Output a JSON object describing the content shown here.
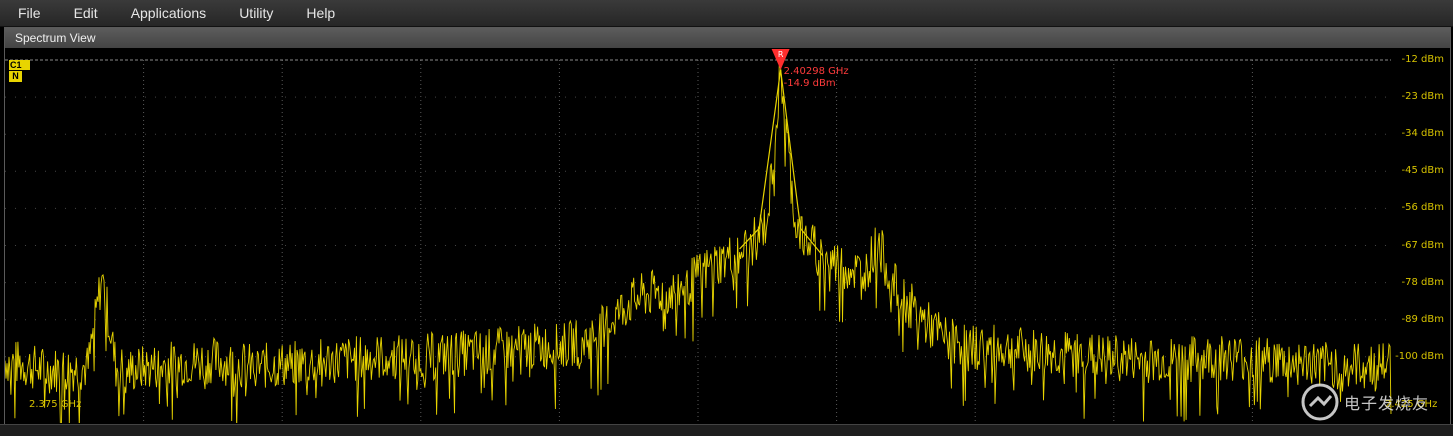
{
  "menu": [
    "File",
    "Edit",
    "Applications",
    "Utility",
    "Help"
  ],
  "panel": {
    "title": "Spectrum View"
  },
  "channel_badge": {
    "channel": "C1",
    "mode": "N"
  },
  "colors": {
    "trace": "#e8d400",
    "marker": "#ff2e2e",
    "grid": "#5a5a5a"
  },
  "marker": {
    "symbol": "R",
    "freq_label": "2.40298 GHz",
    "level_label": "-14.9 dBm"
  },
  "watermark": {
    "text": "电子发烧友"
  },
  "chart_data": {
    "type": "line",
    "y_tick_labels": [
      "-12 dBm",
      "-23 dBm",
      "-34 dBm",
      "-45 dBm",
      "-56 dBm",
      "-67 dBm",
      "-78 dBm",
      "-89 dBm",
      "-100 dBm"
    ],
    "ylim": [
      -122,
      -12
    ],
    "xlim": [
      2.375,
      2.425
    ],
    "x_start_label": "2.375 GHz",
    "x_end_label": "2.425 GHz",
    "grid": true,
    "series": [
      {
        "x": [
          2.375,
          2.3765,
          2.378,
          2.3785,
          2.379,
          2.3795,
          2.381,
          2.3825,
          2.384,
          2.3855,
          2.387,
          2.3885,
          2.39,
          2.3915,
          2.393,
          2.394,
          2.395,
          2.396,
          2.3965,
          2.397,
          2.3975,
          2.398,
          2.3985,
          2.399,
          2.3995,
          2.4,
          2.4005,
          2.401,
          2.4015,
          2.402,
          2.4025,
          2.40298,
          2.4035,
          2.404,
          2.4045,
          2.405,
          2.4055,
          2.406,
          2.4065,
          2.407,
          2.4075,
          2.408,
          2.4085,
          2.409,
          2.4095,
          2.41,
          2.4115,
          2.413,
          2.4145,
          2.416,
          2.4175,
          2.419,
          2.4205,
          2.422,
          2.4235,
          2.425
        ],
        "y": [
          -101,
          -104,
          -103,
          -76,
          -103,
          -104,
          -102,
          -101,
          -103,
          -102,
          -101,
          -100,
          -100,
          -99,
          -98,
          -97,
          -97,
          -95,
          -92,
          -88,
          -84,
          -82,
          -81,
          -81,
          -79,
          -76,
          -73,
          -71,
          -69,
          -66,
          -60,
          -14.9,
          -60,
          -66,
          -70,
          -72,
          -74,
          -75,
          -66,
          -78,
          -83,
          -88,
          -92,
          -95,
          -96,
          -97,
          -98,
          -99,
          -100,
          -101,
          -101,
          -100,
          -101,
          -102,
          -103,
          -102
        ]
      }
    ]
  }
}
